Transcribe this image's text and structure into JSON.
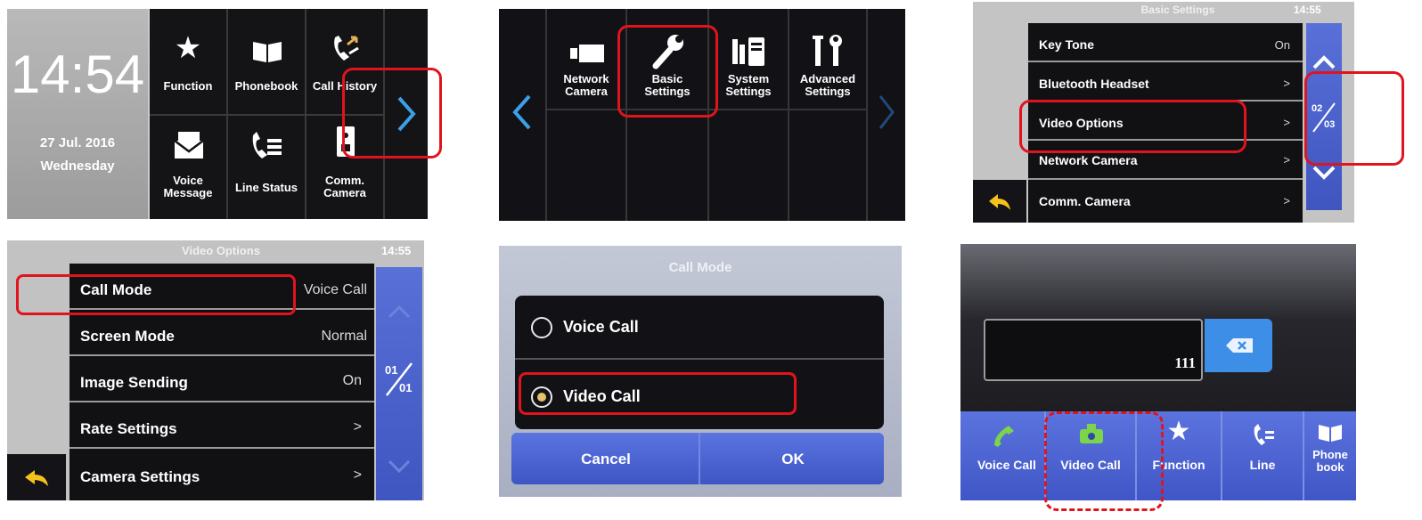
{
  "panel1": {
    "time": "14:54",
    "date": "27 Jul. 2016",
    "weekday": "Wednesday",
    "tiles": [
      {
        "label": "Function",
        "icon": "star-icon"
      },
      {
        "label": "Phonebook",
        "icon": "book-icon"
      },
      {
        "label": "Call History",
        "icon": "call-history-icon"
      },
      {
        "label": "Voice\nMessage",
        "icon": "envelope-icon"
      },
      {
        "label": "Line Status",
        "icon": "phone-list-icon"
      },
      {
        "label": "Comm.\nCamera",
        "icon": "camera-box-icon"
      }
    ],
    "next_icon": "chevron-right-icon"
  },
  "panel2": {
    "tiles": [
      {
        "label": "Network\nCamera",
        "icon": "network-camera-icon"
      },
      {
        "label": "Basic\nSettings",
        "icon": "wrench-icon"
      },
      {
        "label": "System\nSettings",
        "icon": "system-settings-icon"
      },
      {
        "label": "Advanced\nSettings",
        "icon": "tools-icon"
      }
    ],
    "prev_icon": "chevron-left-icon"
  },
  "panel3": {
    "title": "Basic Settings",
    "time": "14:55",
    "items": [
      {
        "label": "Key Tone",
        "value": "On"
      },
      {
        "label": "Bluetooth Headset",
        "value": ">"
      },
      {
        "label": "Video Options",
        "value": ">"
      },
      {
        "label": "Network Camera",
        "value": ">"
      },
      {
        "label": "Comm. Camera",
        "value": ">"
      }
    ],
    "page_num": "02",
    "page_total": "03"
  },
  "panel4": {
    "title": "Video Options",
    "time": "14:55",
    "items": [
      {
        "label": "Call Mode",
        "value": "Voice Call"
      },
      {
        "label": "Screen Mode",
        "value": "Normal"
      },
      {
        "label": "Image Sending",
        "value": "On"
      },
      {
        "label": "Rate Settings",
        "value": ">"
      },
      {
        "label": "Camera Settings",
        "value": ">"
      }
    ],
    "page_num": "01",
    "page_total": "01"
  },
  "panel5": {
    "title": "Call Mode",
    "options": [
      {
        "label": "Voice Call",
        "selected": false
      },
      {
        "label": "Video Call",
        "selected": true
      }
    ],
    "cancel": "Cancel",
    "ok": "OK"
  },
  "panel6": {
    "number": "111",
    "buttons": [
      {
        "label": "Voice Call",
        "icon": "handset-icon"
      },
      {
        "label": "Video Call",
        "icon": "video-call-icon"
      },
      {
        "label": "Function",
        "icon": "star-icon"
      },
      {
        "label": "Line",
        "icon": "line-icon"
      },
      {
        "label": "Phone\nbook",
        "icon": "book-icon"
      }
    ]
  },
  "colors": {
    "highlight": "#e0141c",
    "accent_blue": "#4a62cf",
    "dark_bg": "#16161a"
  }
}
